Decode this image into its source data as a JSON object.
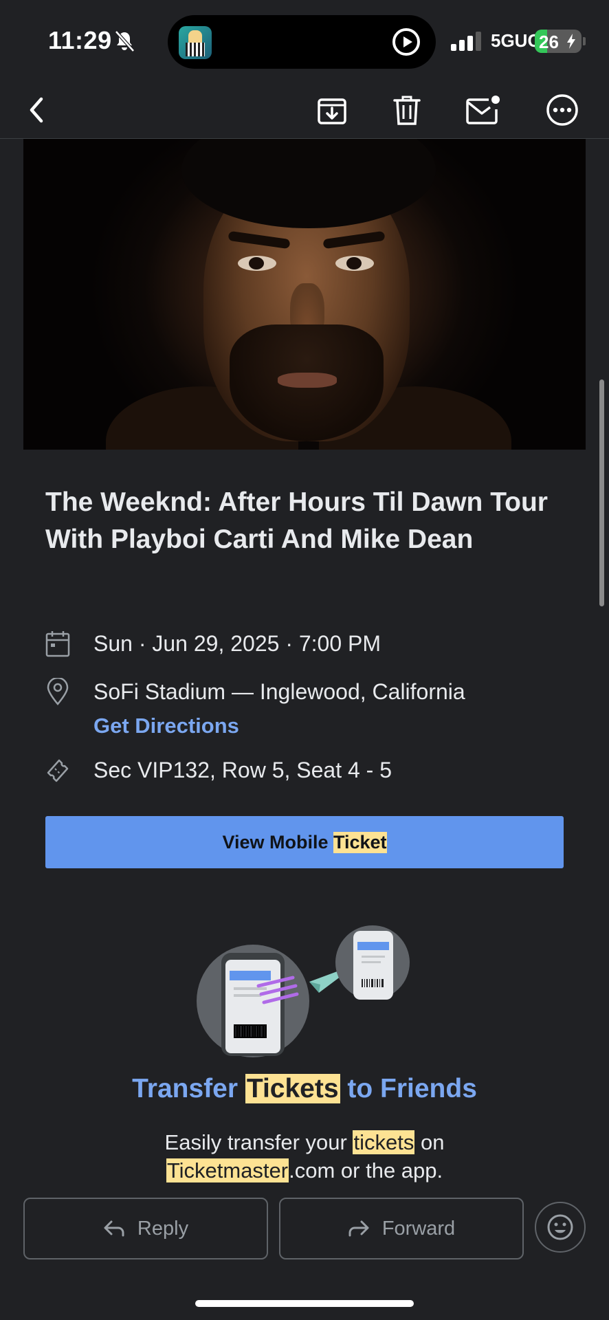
{
  "status_bar": {
    "time": "11:29",
    "network": "5GUC",
    "battery_percent": "26",
    "battery_level": 0.26,
    "icons": [
      "bell-slash-icon",
      "play-circle-icon",
      "signal-icon",
      "charging-bolt-icon"
    ]
  },
  "toolbar": {
    "icons": [
      "back-chevron-icon",
      "archive-icon",
      "trash-icon",
      "mark-unread-icon",
      "more-icon"
    ]
  },
  "hero": {
    "icon": "artist-photo"
  },
  "event": {
    "title": "The Weeknd: After Hours Til Dawn Tour With Playboi Carti And Mike Dean",
    "date_time": "Sun · Jun 29, 2025 · 7:00 PM",
    "venue": "SoFi Stadium — Inglewood, California",
    "directions_label": "Get Directions",
    "seats": "Sec VIP132, Row 5, Seat 4 - 5"
  },
  "cta": {
    "label_prefix": "View Mobile ",
    "label_highlight": "Ticket"
  },
  "transfer": {
    "title_prefix": "Transfer ",
    "title_highlight": "Tickets",
    "title_suffix": " to Friends",
    "body_part1": "Easily transfer your ",
    "body_highlight1": "tickets",
    "body_part2": " on",
    "body_highlight2": "Ticketmaster",
    "body_part3": ".com or the app."
  },
  "actions": {
    "reply_label": "Reply",
    "forward_label": "Forward"
  },
  "colors": {
    "background": "#202124",
    "accent": "#6195ed",
    "link": "#7ba7f0",
    "search_highlight": "#fde293",
    "battery": "#34c759"
  }
}
